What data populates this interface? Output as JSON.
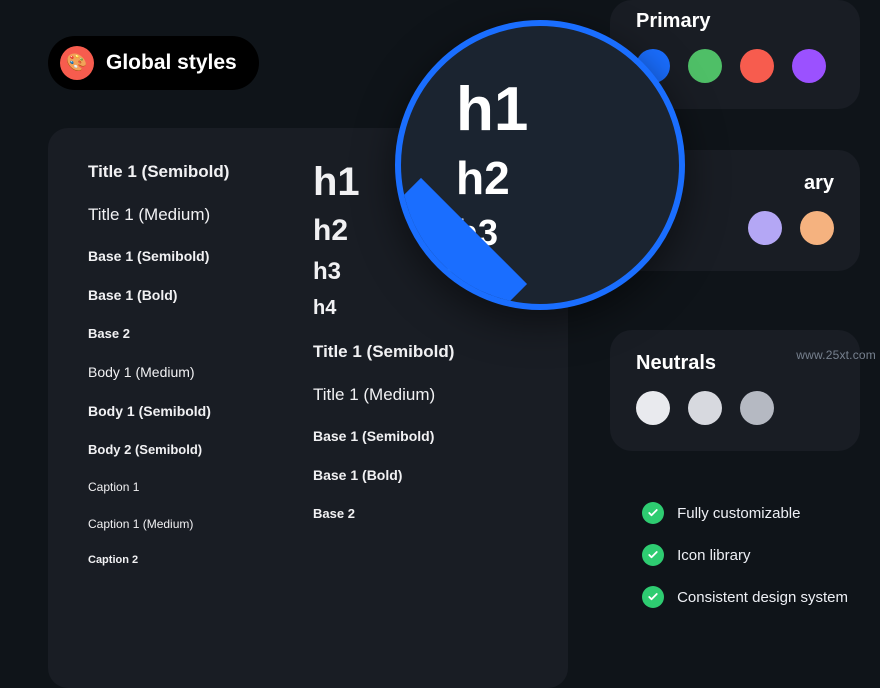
{
  "header": {
    "title": "Global styles",
    "icon": "palette-icon"
  },
  "typography": {
    "left": [
      "Title 1 (Semibold)",
      "Title 1 (Medium)",
      "Base 1 (Semibold)",
      "Base 1 (Bold)",
      "Base 2",
      "Body 1 (Medium)",
      "Body 1 (Semibold)",
      "Body 2 (Semibold)",
      "Caption 1",
      "Caption 1 (Medium)",
      "Caption 2"
    ],
    "right": {
      "h1": "h1",
      "h2": "h2",
      "h3": "h3",
      "h4": "h4",
      "below": [
        "Title 1 (Semibold)",
        "Title 1 (Medium)",
        "Base 1 (Semibold)",
        "Base 1 (Bold)",
        "Base 2"
      ]
    }
  },
  "lens": {
    "h1": "h1",
    "h2": "h2",
    "h3": "h3",
    "plus": "+"
  },
  "colorCards": {
    "primary": {
      "title": "Primary",
      "swatches": [
        "#1a6eff",
        "#4fbf67",
        "#f75c4e",
        "#9b51ff"
      ]
    },
    "secondary": {
      "title": "ary",
      "swatches": [
        "#b4a7f5",
        "#f5b27f"
      ]
    },
    "neutrals": {
      "title": "Neutrals",
      "swatches": [
        "#e9eaee",
        "#d7d9df",
        "#b5b9c2"
      ]
    }
  },
  "features": [
    "Fully customizable",
    "Icon library",
    "Consistent design system"
  ],
  "watermark": "www.25xt.com"
}
